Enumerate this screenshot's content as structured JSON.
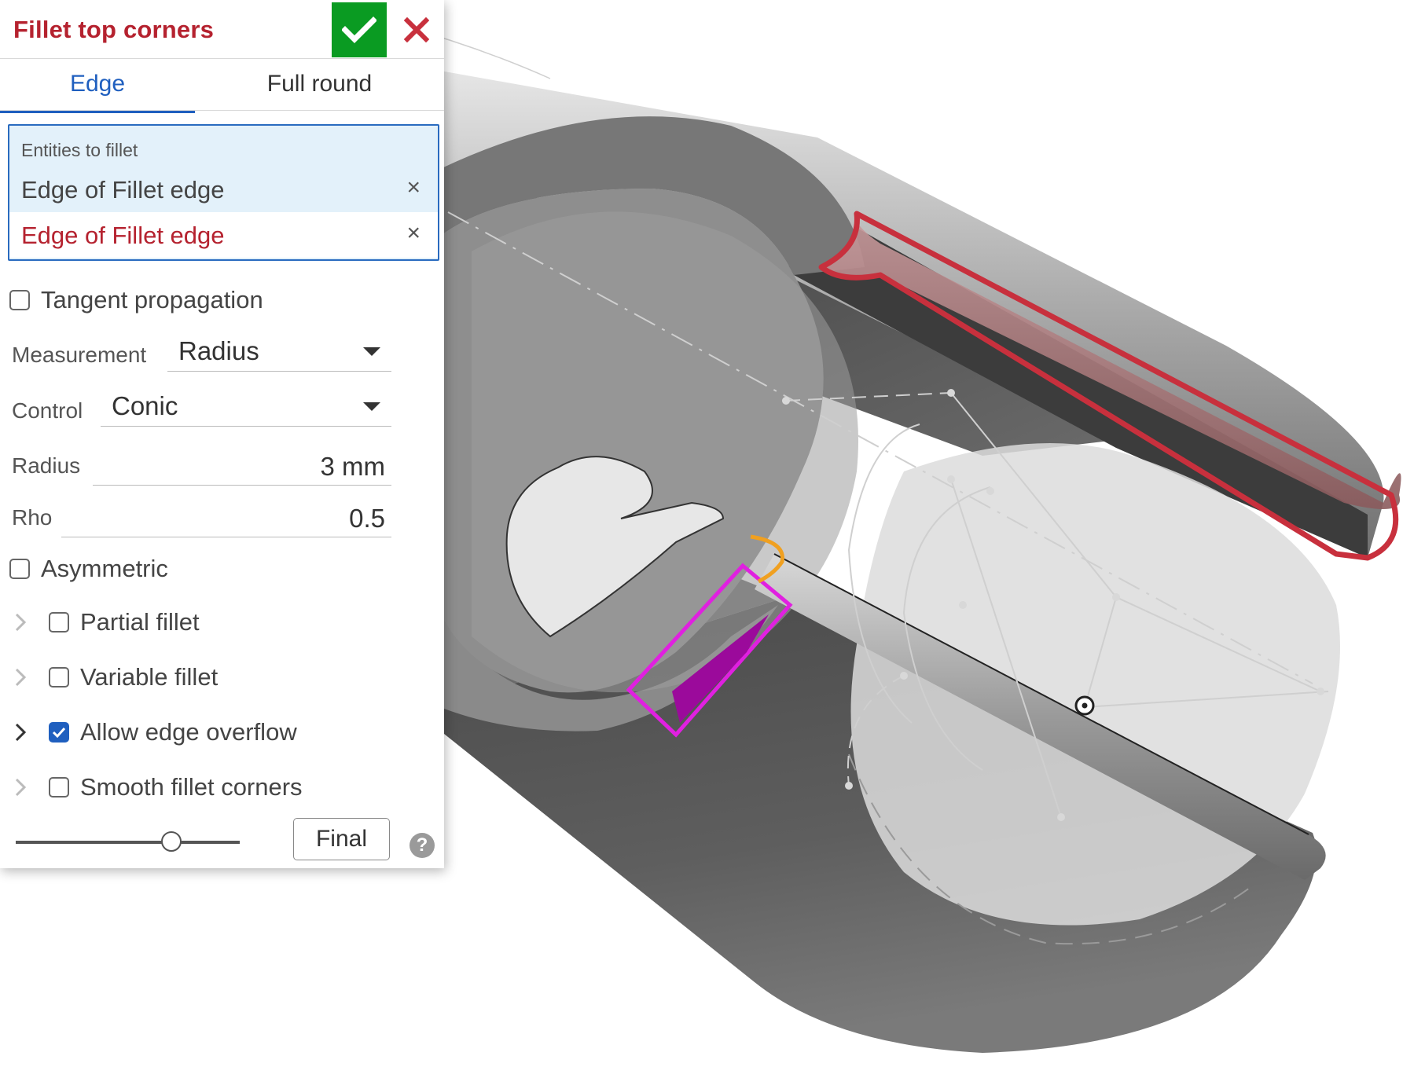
{
  "dialog": {
    "title": "Fillet top corners",
    "tabs": {
      "edge": "Edge",
      "full_round": "Full round",
      "active": "Edge"
    },
    "entities": {
      "label": "Entities to fillet",
      "items": [
        "Edge of Fillet edge",
        "Edge of Fillet edge"
      ],
      "remove_symbol": "×"
    },
    "tangent_propagation": {
      "label": "Tangent propagation",
      "checked": false
    },
    "measurement": {
      "label": "Measurement",
      "value": "Radius"
    },
    "control": {
      "label": "Control",
      "value": "Conic"
    },
    "radius": {
      "label": "Radius",
      "value": "3 mm"
    },
    "rho": {
      "label": "Rho",
      "value": "0.5"
    },
    "asymmetric": {
      "label": "Asymmetric",
      "checked": false
    },
    "partial_fillet": {
      "label": "Partial fillet",
      "checked": false
    },
    "variable_fillet": {
      "label": "Variable fillet",
      "checked": false
    },
    "allow_edge_overflow": {
      "label": "Allow edge overflow",
      "checked": true
    },
    "smooth_fillet_corners": {
      "label": "Smooth fillet corners",
      "checked": false
    },
    "preview_slider_level": 0.68,
    "final_label": "Final",
    "help_symbol": "?"
  },
  "colors": {
    "title": "#b5222f",
    "ok_button": "#0a9b22",
    "active_tab": "#1f5fbf",
    "selected_edge": "#c8303d",
    "magenta_highlight": "#e020e0",
    "orange_highlight": "#f0a020"
  }
}
